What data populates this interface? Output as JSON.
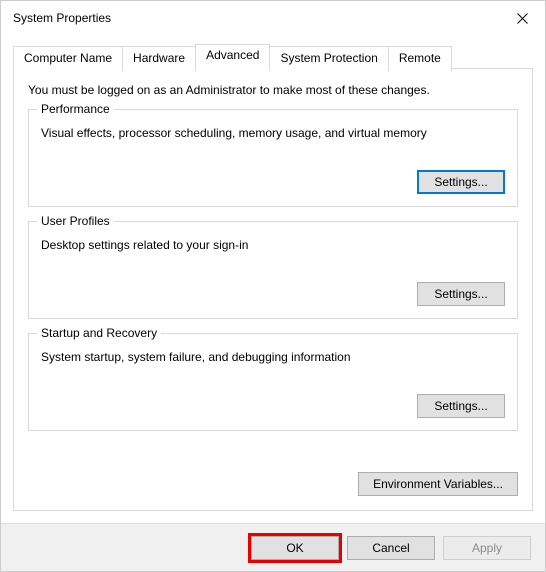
{
  "window": {
    "title": "System Properties"
  },
  "tabs": [
    {
      "label": "Computer Name",
      "active": false
    },
    {
      "label": "Hardware",
      "active": false
    },
    {
      "label": "Advanced",
      "active": true
    },
    {
      "label": "System Protection",
      "active": false
    },
    {
      "label": "Remote",
      "active": false
    }
  ],
  "panel": {
    "intro": "You must be logged on as an Administrator to make most of these changes.",
    "groups": {
      "performance": {
        "title": "Performance",
        "desc": "Visual effects, processor scheduling, memory usage, and virtual memory",
        "button": "Settings..."
      },
      "user_profiles": {
        "title": "User Profiles",
        "desc": "Desktop settings related to your sign-in",
        "button": "Settings..."
      },
      "startup": {
        "title": "Startup and Recovery",
        "desc": "System startup, system failure, and debugging information",
        "button": "Settings..."
      }
    },
    "env_button": "Environment Variables..."
  },
  "buttons": {
    "ok": "OK",
    "cancel": "Cancel",
    "apply": "Apply"
  }
}
